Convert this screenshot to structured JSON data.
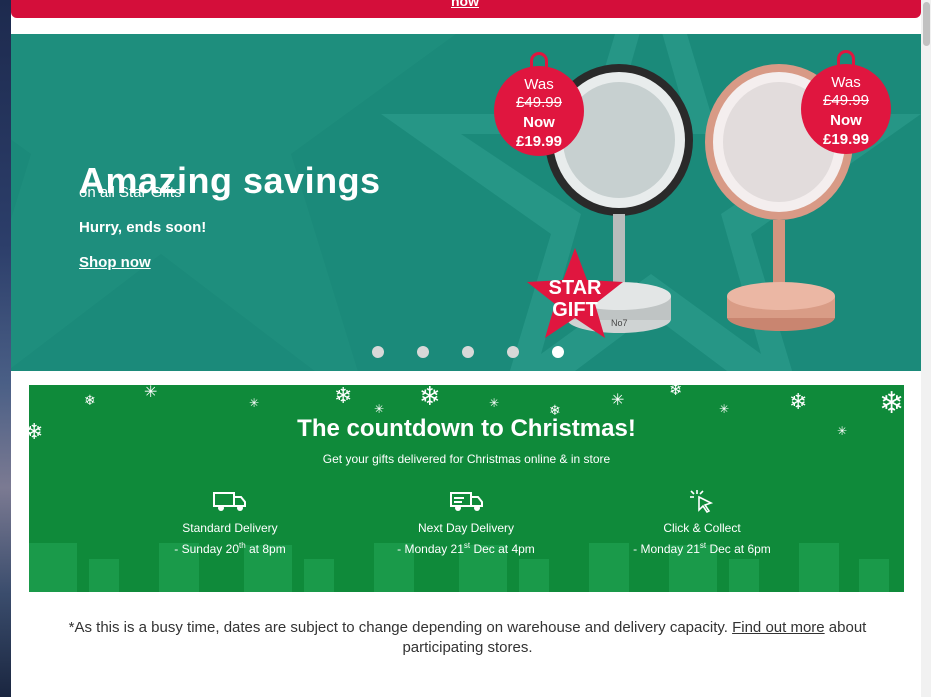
{
  "top_banner": {
    "link_text": "now"
  },
  "hero": {
    "title": "Amazing savings",
    "subtitle": "on all Star Gifts",
    "hurry": "Hurry, ends soon!",
    "cta": "Shop now",
    "tags": [
      {
        "was": "Was",
        "old_price": "£49.99",
        "now": "Now",
        "new_price": "£19.99"
      },
      {
        "was": "Was",
        "old_price": "£49.99",
        "now": "Now",
        "new_price": "£19.99"
      }
    ],
    "badge_line1": "STAR",
    "badge_line2": "GIFT",
    "mirror_label": "No7",
    "active_slide": 4,
    "slides": 5
  },
  "countdown": {
    "title": "The countdown to Christmas!",
    "subtitle": "Get your gifts delivered for Christmas online & in store",
    "items": [
      {
        "icon": "truck-icon",
        "name": "Standard Delivery",
        "pre": "- Sunday 20",
        "sup": "th",
        "post": " at 8pm"
      },
      {
        "icon": "fast-truck-icon",
        "name": "Next Day Delivery",
        "pre": "- Monday 21",
        "sup": "st",
        "post": " Dec at 4pm"
      },
      {
        "icon": "click-icon",
        "name": "Click & Collect",
        "pre": "- Monday 21",
        "sup": "st",
        "post": " Dec at 6pm"
      }
    ]
  },
  "note": {
    "before": "*As this is a busy time, dates are subject to change depending on warehouse and delivery capacity. ",
    "link": "Find out more",
    "after": " about participating stores."
  },
  "colors": {
    "banner_red": "#d40e3a",
    "hero_teal": "#1b8a7a",
    "christmas_green": "#0f8a3a",
    "tag_red": "#e0163f"
  }
}
